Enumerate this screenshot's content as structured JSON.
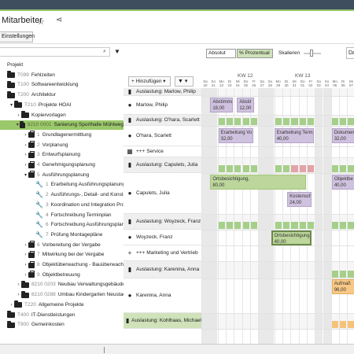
{
  "header": {
    "title": "Mitarbeiter",
    "settings_label": "Einstellungen"
  },
  "tree": {
    "items": [
      {
        "indent": 0,
        "toggle": "",
        "icon": "none",
        "code": "",
        "label": "Projekt"
      },
      {
        "indent": 0,
        "toggle": "",
        "icon": "folder",
        "code": "T099",
        "label": "Fehlzeiten"
      },
      {
        "indent": 0,
        "toggle": "",
        "icon": "folder",
        "code": "T100",
        "label": "Softwareentwicklung"
      },
      {
        "indent": 0,
        "toggle": "",
        "icon": "folder",
        "code": "T200",
        "label": "Architektur"
      },
      {
        "indent": 1,
        "toggle": "▾",
        "icon": "folder",
        "code": "T210",
        "label": "Projekte HOAI"
      },
      {
        "indent": 2,
        "toggle": "›",
        "icon": "folder",
        "code": "",
        "label": "Kopiervorlagen"
      },
      {
        "indent": 2,
        "toggle": "▾",
        "icon": "folder",
        "code": "8210 0001",
        "label": "Sanierung Sporthalle Mühlweg",
        "selected": true
      },
      {
        "indent": 3,
        "toggle": "›",
        "icon": "brief",
        "code": "1",
        "label": "Grundlagenermittlung"
      },
      {
        "indent": 3,
        "toggle": "›",
        "icon": "brief",
        "code": "2",
        "label": "Vorplanung"
      },
      {
        "indent": 3,
        "toggle": "›",
        "icon": "brief",
        "code": "3",
        "label": "Entwurfsplanung"
      },
      {
        "indent": 3,
        "toggle": "›",
        "icon": "brief",
        "code": "4",
        "label": "Genehmigungsplanung"
      },
      {
        "indent": 3,
        "toggle": "▾",
        "icon": "brief",
        "code": "5",
        "label": "Ausführungsplanung"
      },
      {
        "indent": 4,
        "toggle": "",
        "icon": "tool",
        "code": "1",
        "label": "Erarbeitung Ausführungsplanung"
      },
      {
        "indent": 4,
        "toggle": "",
        "icon": "tool",
        "code": "2",
        "label": "Ausführungs-, Detail- und Konstrukt"
      },
      {
        "indent": 4,
        "toggle": "",
        "icon": "tool",
        "code": "3",
        "label": "Koordination und Integration Projekt"
      },
      {
        "indent": 4,
        "toggle": "",
        "icon": "tool",
        "code": "4",
        "label": "Fortschreibung Terminplan"
      },
      {
        "indent": 4,
        "toggle": "",
        "icon": "tool",
        "code": "6",
        "label": "Fortschreibung Ausführungsplanun"
      },
      {
        "indent": 4,
        "toggle": "",
        "icon": "tool",
        "code": "7",
        "label": "Prüfung Montagepläne"
      },
      {
        "indent": 3,
        "toggle": "›",
        "icon": "brief",
        "code": "6",
        "label": "Vorbereitung der Vergabe"
      },
      {
        "indent": 3,
        "toggle": "›",
        "icon": "brief",
        "code": "7",
        "label": "Mitwirkung bei der Vergabe"
      },
      {
        "indent": 3,
        "toggle": "›",
        "icon": "brief",
        "code": "8",
        "label": "Objektüberwachung - Bauüberwachung"
      },
      {
        "indent": 3,
        "toggle": "›",
        "icon": "brief",
        "code": "9",
        "label": "Objektbetreuung"
      },
      {
        "indent": 2,
        "toggle": "›",
        "icon": "folder",
        "code": "8210 0203",
        "label": "Neubau Verwaltungsgebäude Stein"
      },
      {
        "indent": 2,
        "toggle": "›",
        "icon": "folder",
        "code": "8210 0288",
        "label": "Umbau Kindergarten Neustadt"
      },
      {
        "indent": 1,
        "toggle": "›",
        "icon": "folder",
        "code": "T220",
        "label": "Allgemeine Projekte"
      },
      {
        "indent": 0,
        "toggle": "",
        "icon": "folder",
        "code": "T400",
        "label": "IT-Dienstleistungen"
      },
      {
        "indent": 0,
        "toggle": "",
        "icon": "folder",
        "code": "T900",
        "label": "Gemeinkosten"
      }
    ]
  },
  "toolbar": {
    "add_label": "+ Hinzufügen ▾",
    "filter_label": "▼ ▾"
  },
  "resources": {
    "rows": [
      {
        "kind": "util",
        "icon": "▮",
        "label": "Auslastung: Marlow, Philip",
        "h": 10
      },
      {
        "kind": "person",
        "icon": "●",
        "label": "Marlow, Philip",
        "h": 24
      },
      {
        "kind": "util",
        "icon": "▮",
        "label": "Auslastung: O'hara, Scarlett",
        "h": 14
      },
      {
        "kind": "person",
        "icon": "●",
        "label": "O'hara, Scarlett",
        "h": 26
      },
      {
        "kind": "service",
        "icon": "▦",
        "label": "+++ Service",
        "h": 14
      },
      {
        "kind": "util",
        "icon": "▮",
        "label": "Auslastung: Capulets, Julia",
        "h": 20
      },
      {
        "kind": "person",
        "icon": "●",
        "label": "Capulets, Julia",
        "h": 52
      },
      {
        "kind": "util",
        "icon": "▮",
        "label": "Auslastung: Woyzeck, Franz",
        "h": 20
      },
      {
        "kind": "person",
        "icon": "●",
        "label": "Woyzeck, Franz",
        "h": 20
      },
      {
        "kind": "service",
        "icon": "+",
        "label": "+++ Marketing und Vertrieb",
        "h": 20
      },
      {
        "kind": "util",
        "icon": "▮",
        "label": "Auslastung: Karenina, Anna",
        "h": 22
      },
      {
        "kind": "person",
        "icon": "●",
        "label": "Karenina, Anna",
        "h": 44
      },
      {
        "kind": "util",
        "icon": "▮",
        "label": "Auslastung: Kohlhaas, Michael",
        "h": 20,
        "highlight": true
      }
    ]
  },
  "grid": {
    "absolut_label": "Absolut",
    "prozentual_label": "% Prozentual",
    "scale_label": "Skalieren",
    "date_label": "Da",
    "weeks": [
      {
        "label": "KW 12"
      },
      {
        "label": "KW 13"
      }
    ],
    "days": [
      {
        "dn": "Sa",
        "d": "20"
      },
      {
        "dn": "So",
        "d": "21"
      },
      {
        "dn": "Mo",
        "d": "22"
      },
      {
        "dn": "Di",
        "d": "23"
      },
      {
        "dn": "Mi",
        "d": "24"
      },
      {
        "dn": "Do",
        "d": "25"
      },
      {
        "dn": "Fr",
        "d": "26"
      },
      {
        "dn": "Sa",
        "d": "27"
      },
      {
        "dn": "So",
        "d": "28"
      },
      {
        "dn": "Mo",
        "d": "29"
      },
      {
        "dn": "Di",
        "d": "30"
      },
      {
        "dn": "Mi",
        "d": "31"
      },
      {
        "dn": "Do",
        "d": "01"
      },
      {
        "dn": "Fr",
        "d": "02"
      },
      {
        "dn": "Sa",
        "d": "03"
      },
      {
        "dn": "So",
        "d": "04"
      },
      {
        "dn": "Mo",
        "d": "05"
      },
      {
        "dn": "Di",
        "d": "06"
      },
      {
        "dn": "Mi",
        "d": "07"
      }
    ],
    "tasks": [
      {
        "label": "Abstimmu",
        "value": "18,00",
        "color": "purple"
      },
      {
        "label": "Abstir",
        "value": "12,00",
        "color": "purple"
      },
      {
        "label": "Erarbeitung Vo",
        "value": "32,00",
        "color": "purple"
      },
      {
        "label": "Erarbeitung Terminp",
        "value": "40,00",
        "color": "purple"
      },
      {
        "label": "Dokumen",
        "value": "32,00",
        "color": "purple"
      },
      {
        "label": "Ortsbesichtigung,",
        "value": "80,00",
        "color": "green"
      },
      {
        "label": "Objektbe",
        "value": "40,00",
        "color": "purple"
      },
      {
        "label": "Kostensch",
        "value": "24,00",
        "color": "purple"
      },
      {
        "label": "Ortsbesichtigung,",
        "value": "40,00",
        "color": "green"
      },
      {
        "label": "Aufmaß",
        "value": "96,00",
        "color": "orange"
      }
    ]
  }
}
